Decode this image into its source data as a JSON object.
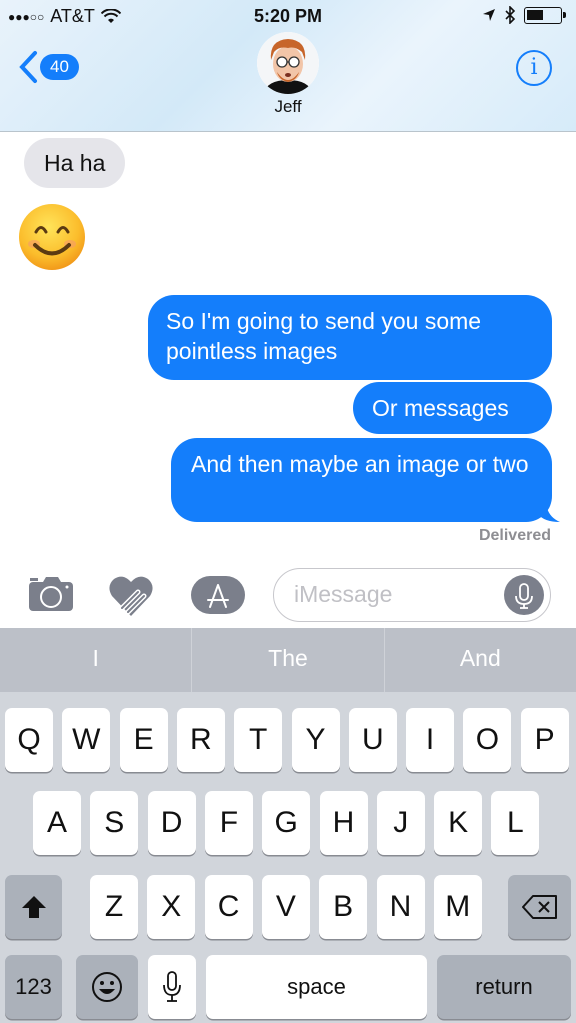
{
  "status_bar": {
    "signal": "●●●○○",
    "carrier": "AT&T",
    "time": "5:20 PM"
  },
  "nav": {
    "back_badge": "40",
    "contact_name": "Jeff",
    "info_label": "i"
  },
  "messages": [
    {
      "direction": "incoming",
      "text": "Ha ha"
    },
    {
      "direction": "incoming",
      "text": "😊",
      "type": "emoji"
    },
    {
      "direction": "outgoing",
      "text": "So I'm going to send you some pointless images"
    },
    {
      "direction": "outgoing",
      "text": "Or messages"
    },
    {
      "direction": "outgoing",
      "text": "And then maybe an image or two"
    }
  ],
  "delivery_status": "Delivered",
  "composer": {
    "placeholder": "iMessage",
    "value": ""
  },
  "keyboard": {
    "predictions": [
      "I",
      "The",
      "And"
    ],
    "row1": [
      "Q",
      "W",
      "E",
      "R",
      "T",
      "Y",
      "U",
      "I",
      "O",
      "P"
    ],
    "row2": [
      "A",
      "S",
      "D",
      "F",
      "G",
      "H",
      "J",
      "K",
      "L"
    ],
    "row3": [
      "Z",
      "X",
      "C",
      "V",
      "B",
      "N",
      "M"
    ],
    "numbers_label": "123",
    "space_label": "space",
    "return_label": "return"
  },
  "colors": {
    "accent": "#147efb",
    "incoming_bubble": "#e5e5ea",
    "keyboard_bg": "#d1d5db"
  }
}
